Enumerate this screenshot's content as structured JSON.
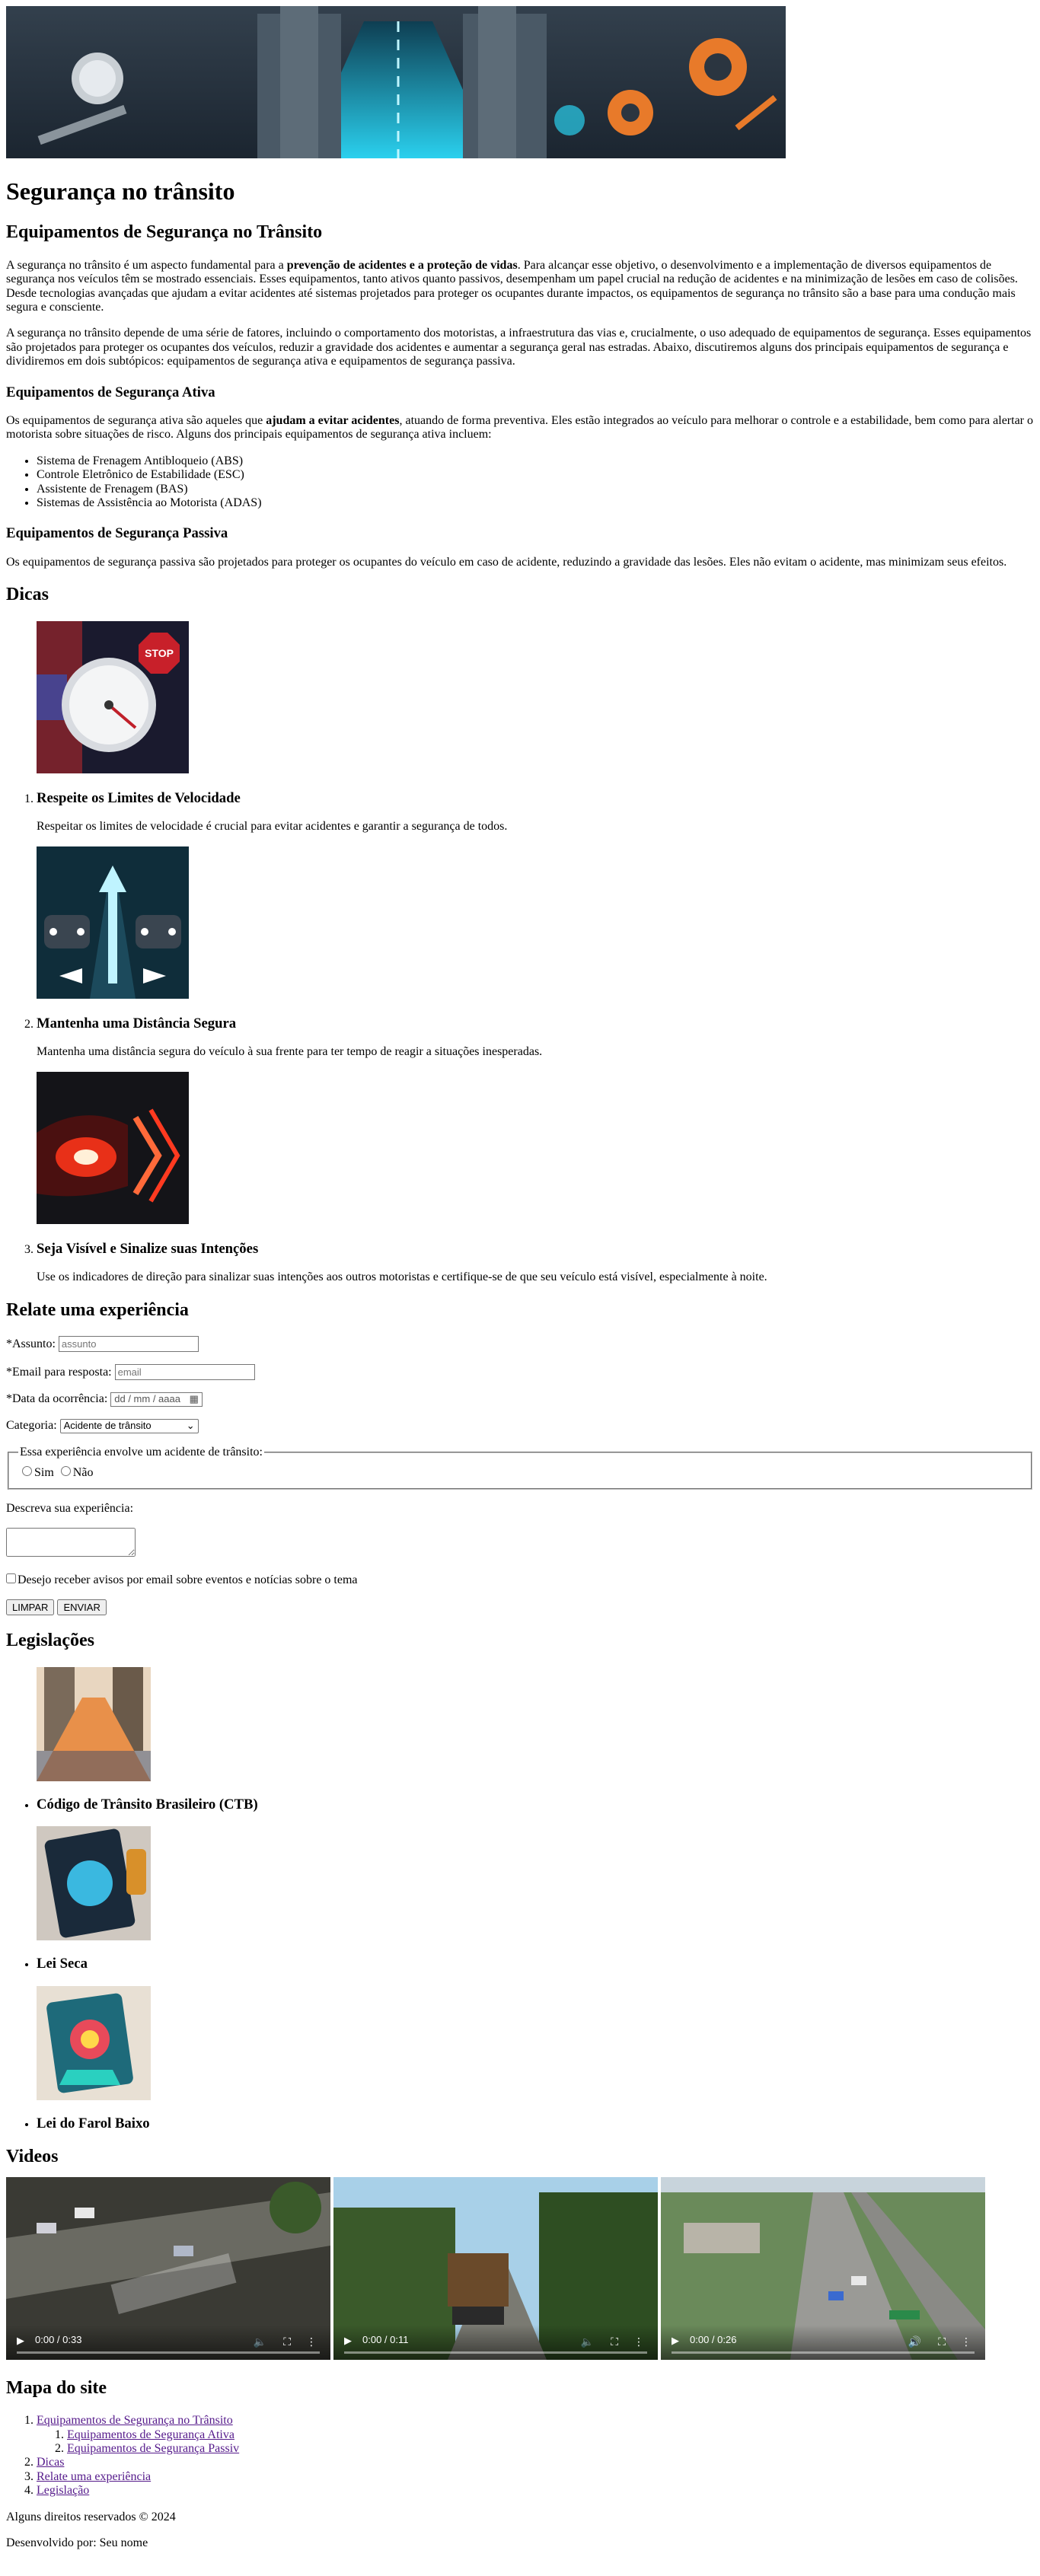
{
  "page": {
    "title": "Segurança no trânsito"
  },
  "equipamentos": {
    "heading": "Equipamentos de Segurança no Trânsito",
    "p1_before": "A segurança no trânsito é um aspecto fundamental para a ",
    "p1_bold": "prevenção de acidentes e a proteção de vidas",
    "p1_after": ". Para alcançar esse objetivo, o desenvolvimento e a implementação de diversos equipamentos de segurança nos veículos têm se mostrado essenciais. Esses equipamentos, tanto ativos quanto passivos, desempenham um papel crucial na redução de acidentes e na minimização de lesões em caso de colisões. Desde tecnologias avançadas que ajudam a evitar acidentes até sistemas projetados para proteger os ocupantes durante impactos, os equipamentos de segurança no trânsito são a base para uma condução mais segura e consciente.",
    "p2": "A segurança no trânsito depende de uma série de fatores, incluindo o comportamento dos motoristas, a infraestrutura das vias e, crucialmente, o uso adequado de equipamentos de segurança. Esses equipamentos são projetados para proteger os ocupantes dos veículos, reduzir a gravidade dos acidentes e aumentar a segurança geral nas estradas. Abaixo, discutiremos alguns dos principais equipamentos de segurança e dividiremos em dois subtópicos: equipamentos de segurança ativa e equipamentos de segurança passiva.",
    "ativa": {
      "heading": "Equipamentos de Segurança Ativa",
      "p_before": "Os equipamentos de segurança ativa são aqueles que ",
      "p_bold": "ajudam a evitar acidentes",
      "p_after": ", atuando de forma preventiva. Eles estão integrados ao veículo para melhorar o controle e a estabilidade, bem como para alertar o motorista sobre situações de risco. Alguns dos principais equipamentos de segurança ativa incluem:",
      "items": [
        "Sistema de Frenagem Antibloqueio (ABS)",
        "Controle Eletrônico de Estabilidade (ESC)",
        "Assistente de Frenagem (BAS)",
        "Sistemas de Assistência ao Motorista (ADAS)"
      ]
    },
    "passiva": {
      "heading": "Equipamentos de Segurança Passiva",
      "p": "Os equipamentos de segurança passiva são projetados para proteger os ocupantes do veículo em caso de acidente, reduzindo a gravidade das lesões. Eles não evitam o acidente, mas minimizam seus efeitos."
    }
  },
  "dicas": {
    "heading": "Dicas",
    "items": [
      {
        "title": "Respeite os Limites de Velocidade",
        "text": "Respeitar os limites de velocidade é crucial para evitar acidentes e garantir a segurança de todos.",
        "stop_text": "STOP"
      },
      {
        "title": "Mantenha uma Distância Segura",
        "text": "Mantenha uma distância segura do veículo à sua frente para ter tempo de reagir a situações inesperadas."
      },
      {
        "title": "Seja Visível e Sinalize suas Intenções",
        "text": "Use os indicadores de direção para sinalizar suas intenções aos outros motoristas e certifique-se de que seu veículo está visível, especialmente à noite."
      }
    ]
  },
  "form": {
    "heading": "Relate uma experiência",
    "assunto_label": "*Assunto:",
    "assunto_placeholder": "assunto",
    "email_label": "*Email para resposta:",
    "email_placeholder": "email",
    "data_label": "*Data da ocorrência:",
    "data_value": "dd / mm / aaaa",
    "categoria_label": "Categoria:",
    "categoria_value": "Acidente de trânsito",
    "legend": "Essa experiência envolve um acidente de trânsito:",
    "sim": "Sim",
    "nao": "Não",
    "descreva_label": "Descreva sua experiência:",
    "checkbox_label": "Desejo receber avisos por email sobre eventos e notícias sobre o tema",
    "limpar": "LIMPAR",
    "enviar": "ENVIAR"
  },
  "legislacoes": {
    "heading": "Legislações",
    "items": [
      {
        "title": "Código de Trânsito Brasileiro (CTB)"
      },
      {
        "title": "Lei Seca"
      },
      {
        "title": "Lei do Farol Baixo"
      }
    ]
  },
  "videos": {
    "heading": "Videos",
    "items": [
      {
        "time": "0:00 / 0:33"
      },
      {
        "time": "0:00 / 0:11"
      },
      {
        "time": "0:00 / 0:26"
      }
    ]
  },
  "mapa": {
    "heading": "Mapa do site",
    "links": {
      "equipamentos": "Equipamentos de Segurança no Trânsito",
      "ativa": "Equipamentos de Segurança Ativa",
      "passiva": "Equipamentos de Segurança Passiv",
      "dicas": "Dicas",
      "relate": "Relate uma experiência",
      "legislacao": "Legislação"
    }
  },
  "footer": {
    "rights": "Alguns direitos reservados © 2024",
    "dev": "Desenvolvido por: Seu nome"
  },
  "colors": {
    "link": "#551a8b",
    "banner_dark": "#1e2a38",
    "banner_road": "#23c9e8",
    "gear": "#e87a2a"
  }
}
